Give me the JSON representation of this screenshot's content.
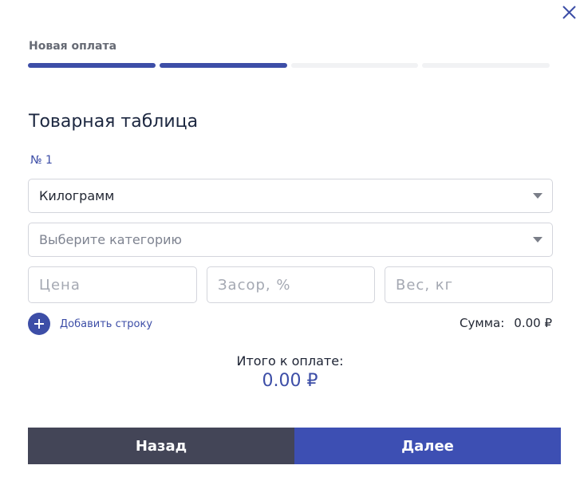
{
  "header": {
    "step_title": "Новая оплата",
    "progress": {
      "total_steps": 4,
      "completed_steps": 2
    }
  },
  "form": {
    "section_title": "Товарная таблица",
    "row_number": "№ 1",
    "unit_select": {
      "value": "Килограмм"
    },
    "category_select": {
      "placeholder": "Выберите категорию"
    },
    "price_input": {
      "placeholder": "Цена",
      "value": ""
    },
    "waste_input": {
      "placeholder": "Засор, %",
      "value": ""
    },
    "weight_input": {
      "placeholder": "Вес, кг",
      "value": ""
    },
    "add_row_label": "Добавить строку",
    "sum_label": "Сумма:",
    "sum_value": "0.00 ₽"
  },
  "total": {
    "label": "Итого к оплате:",
    "value": "0.00 ₽"
  },
  "footer": {
    "back_label": "Назад",
    "next_label": "Далее"
  },
  "colors": {
    "accent": "#3d4ea7",
    "back_button": "#434557",
    "next_button": "#3d4fb3"
  },
  "icons": {
    "close": "close-icon",
    "dropdown": "caret-down-icon",
    "add": "plus-icon"
  }
}
